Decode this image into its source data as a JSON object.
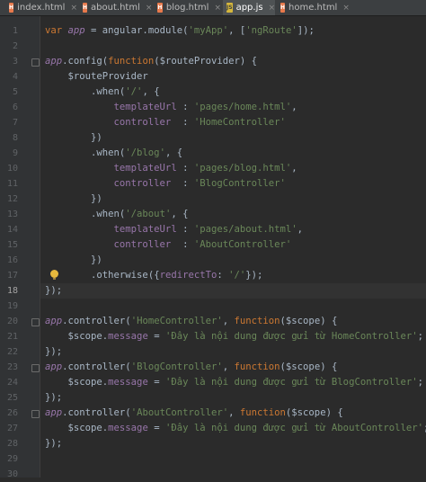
{
  "tabs": [
    {
      "label": "index.html",
      "icon": "html-file-icon",
      "active": false
    },
    {
      "label": "about.html",
      "icon": "html-file-icon",
      "active": false
    },
    {
      "label": "blog.html",
      "icon": "html-file-icon",
      "active": false
    },
    {
      "label": "app.js",
      "icon": "js-file-icon",
      "active": true
    },
    {
      "label": "home.html",
      "icon": "html-file-icon",
      "active": false
    }
  ],
  "file_icon_text": {
    "html": "H",
    "js": "JS"
  },
  "close_glyph": "×",
  "current_line": 18,
  "colors": {
    "keyword": "#cc7832",
    "function": "#ffc66d",
    "string": "#6a8759",
    "variable": "#9876aa",
    "text": "#a9b7c6",
    "background": "#2b2b2b"
  },
  "lines": [
    {
      "n": "1",
      "tokens": [
        {
          "t": "var ",
          "c": "kw"
        },
        {
          "t": "app",
          "c": "var"
        },
        {
          "t": " = angular.",
          "c": "plain"
        },
        {
          "t": "module",
          "c": "plain"
        },
        {
          "t": "(",
          "c": "plain"
        },
        {
          "t": "'myApp'",
          "c": "str"
        },
        {
          "t": ", [",
          "c": "plain"
        },
        {
          "t": "'ngRoute'",
          "c": "str"
        },
        {
          "t": "]);",
          "c": "plain"
        }
      ]
    },
    {
      "n": "2",
      "tokens": []
    },
    {
      "n": "3",
      "tokens": [
        {
          "t": "app",
          "c": "var"
        },
        {
          "t": ".config(",
          "c": "plain"
        },
        {
          "t": "function",
          "c": "kw"
        },
        {
          "t": "($routeProvider) {",
          "c": "plain"
        }
      ]
    },
    {
      "n": "4",
      "tokens": [
        {
          "t": "    $routeProvider",
          "c": "plain"
        }
      ]
    },
    {
      "n": "5",
      "tokens": [
        {
          "t": "        .when(",
          "c": "plain"
        },
        {
          "t": "'/'",
          "c": "str"
        },
        {
          "t": ", {",
          "c": "plain"
        }
      ]
    },
    {
      "n": "6",
      "tokens": [
        {
          "t": "            templateUrl",
          "c": "prop"
        },
        {
          "t": " : ",
          "c": "plain"
        },
        {
          "t": "'pages/home.html'",
          "c": "str"
        },
        {
          "t": ",",
          "c": "plain"
        }
      ]
    },
    {
      "n": "7",
      "tokens": [
        {
          "t": "            controller ",
          "c": "prop"
        },
        {
          "t": " : ",
          "c": "plain"
        },
        {
          "t": "'HomeController'",
          "c": "str"
        }
      ]
    },
    {
      "n": "8",
      "tokens": [
        {
          "t": "        })",
          "c": "plain"
        }
      ]
    },
    {
      "n": "9",
      "tokens": [
        {
          "t": "        .when(",
          "c": "plain"
        },
        {
          "t": "'/blog'",
          "c": "str"
        },
        {
          "t": ", {",
          "c": "plain"
        }
      ]
    },
    {
      "n": "10",
      "tokens": [
        {
          "t": "            templateUrl",
          "c": "prop"
        },
        {
          "t": " : ",
          "c": "plain"
        },
        {
          "t": "'pages/blog.html'",
          "c": "str"
        },
        {
          "t": ",",
          "c": "plain"
        }
      ]
    },
    {
      "n": "11",
      "tokens": [
        {
          "t": "            controller ",
          "c": "prop"
        },
        {
          "t": " : ",
          "c": "plain"
        },
        {
          "t": "'BlogController'",
          "c": "str"
        }
      ]
    },
    {
      "n": "12",
      "tokens": [
        {
          "t": "        })",
          "c": "plain"
        }
      ]
    },
    {
      "n": "13",
      "tokens": [
        {
          "t": "        .when(",
          "c": "plain"
        },
        {
          "t": "'/about'",
          "c": "str"
        },
        {
          "t": ", {",
          "c": "plain"
        }
      ]
    },
    {
      "n": "14",
      "tokens": [
        {
          "t": "            templateUrl",
          "c": "prop"
        },
        {
          "t": " : ",
          "c": "plain"
        },
        {
          "t": "'pages/about.html'",
          "c": "str"
        },
        {
          "t": ",",
          "c": "plain"
        }
      ]
    },
    {
      "n": "15",
      "tokens": [
        {
          "t": "            controller ",
          "c": "prop"
        },
        {
          "t": " : ",
          "c": "plain"
        },
        {
          "t": "'AboutController'",
          "c": "str"
        }
      ]
    },
    {
      "n": "16",
      "tokens": [
        {
          "t": "        })",
          "c": "plain"
        }
      ]
    },
    {
      "n": "17",
      "tokens": [
        {
          "t": "        .otherwise",
          "c": "plain"
        },
        {
          "t": "({",
          "c": "plain"
        },
        {
          "t": "redirectTo",
          "c": "prop"
        },
        {
          "t": ": ",
          "c": "plain"
        },
        {
          "t": "'/'",
          "c": "str"
        },
        {
          "t": "});",
          "c": "plain"
        }
      ]
    },
    {
      "n": "18",
      "tokens": [
        {
          "t": "});",
          "c": "plain"
        }
      ]
    },
    {
      "n": "19",
      "tokens": []
    },
    {
      "n": "20",
      "tokens": [
        {
          "t": "app",
          "c": "var"
        },
        {
          "t": ".controller(",
          "c": "plain"
        },
        {
          "t": "'HomeController'",
          "c": "str"
        },
        {
          "t": ", ",
          "c": "plain"
        },
        {
          "t": "function",
          "c": "kw"
        },
        {
          "t": "($scope) {",
          "c": "plain"
        }
      ]
    },
    {
      "n": "21",
      "tokens": [
        {
          "t": "    $scope.",
          "c": "plain"
        },
        {
          "t": "message",
          "c": "prop"
        },
        {
          "t": " = ",
          "c": "plain"
        },
        {
          "t": "'Đây là nội dung được gửi từ HomeController'",
          "c": "str"
        },
        {
          "t": ";",
          "c": "plain"
        }
      ]
    },
    {
      "n": "22",
      "tokens": [
        {
          "t": "});",
          "c": "plain"
        }
      ]
    },
    {
      "n": "23",
      "tokens": [
        {
          "t": "app",
          "c": "var"
        },
        {
          "t": ".controller(",
          "c": "plain"
        },
        {
          "t": "'BlogController'",
          "c": "str"
        },
        {
          "t": ", ",
          "c": "plain"
        },
        {
          "t": "function",
          "c": "kw"
        },
        {
          "t": "($scope) {",
          "c": "plain"
        }
      ]
    },
    {
      "n": "24",
      "tokens": [
        {
          "t": "    $scope.",
          "c": "plain"
        },
        {
          "t": "message",
          "c": "prop"
        },
        {
          "t": " = ",
          "c": "plain"
        },
        {
          "t": "'Đây là nội dung được gửi từ BlogController'",
          "c": "str"
        },
        {
          "t": ";",
          "c": "plain"
        }
      ]
    },
    {
      "n": "25",
      "tokens": [
        {
          "t": "});",
          "c": "plain"
        }
      ]
    },
    {
      "n": "26",
      "tokens": [
        {
          "t": "app",
          "c": "var"
        },
        {
          "t": ".controller(",
          "c": "plain"
        },
        {
          "t": "'AboutController'",
          "c": "str"
        },
        {
          "t": ", ",
          "c": "plain"
        },
        {
          "t": "function",
          "c": "kw"
        },
        {
          "t": "($scope) {",
          "c": "plain"
        }
      ]
    },
    {
      "n": "27",
      "tokens": [
        {
          "t": "    $scope.",
          "c": "plain"
        },
        {
          "t": "message",
          "c": "prop"
        },
        {
          "t": " = ",
          "c": "plain"
        },
        {
          "t": "'Đây là nội dung được gửi từ AboutController'",
          "c": "str"
        },
        {
          "t": ";",
          "c": "plain"
        }
      ]
    },
    {
      "n": "28",
      "tokens": [
        {
          "t": "});",
          "c": "plain"
        }
      ]
    },
    {
      "n": "29",
      "tokens": []
    },
    {
      "n": "30",
      "tokens": []
    }
  ]
}
